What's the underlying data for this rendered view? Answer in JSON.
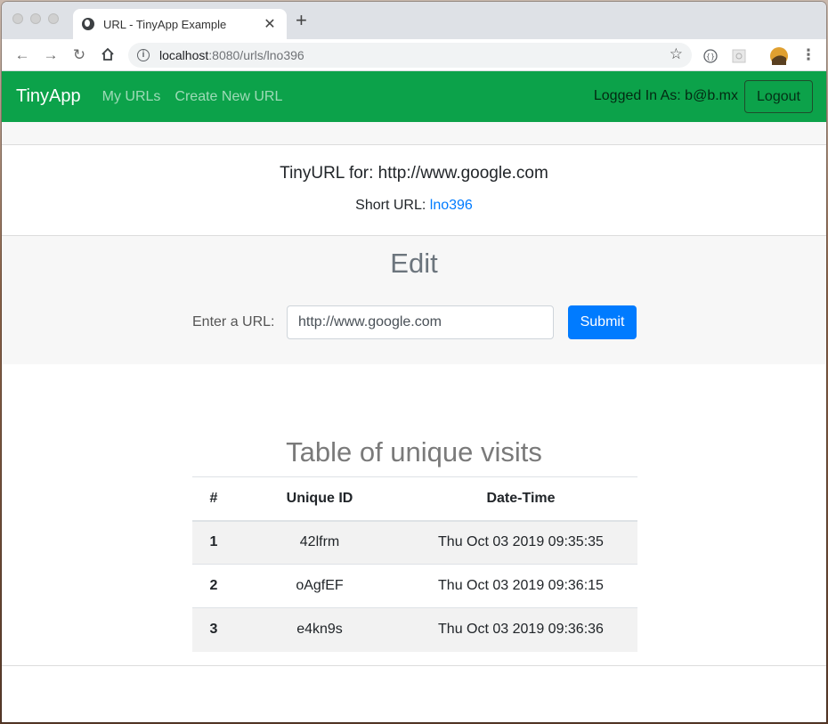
{
  "browser": {
    "tab_title": "URL - TinyApp Example",
    "tab_close": "✕",
    "new_tab": "+",
    "url_host": "localhost",
    "url_path": ":8080/urls/lno396",
    "icons": [
      "back-icon",
      "forward-icon",
      "reload-icon",
      "home-icon",
      "info-icon",
      "star-icon",
      "extension-icon",
      "profile-avatar",
      "menu-icon"
    ]
  },
  "navbar": {
    "brand": "TinyApp",
    "links": [
      "My URLs",
      "Create New URL"
    ],
    "logged_in_text": "Logged In As: b@b.mx",
    "logout_label": "Logout",
    "color": "#0ca24a"
  },
  "url_info": {
    "title": "TinyURL for: http://www.google.com",
    "short_label": "Short URL: ",
    "short_value": "lno396"
  },
  "edit": {
    "heading": "Edit",
    "label": "Enter a URL:",
    "input_value": "http://www.google.com",
    "submit_label": "Submit"
  },
  "visits": {
    "heading": "Table of unique visits",
    "columns": [
      "#",
      "Unique ID",
      "Date-Time"
    ],
    "rows": [
      [
        "1",
        "42lfrm",
        "Thu Oct 03 2019 09:35:35"
      ],
      [
        "2",
        "oAgfEF",
        "Thu Oct 03 2019 09:36:15"
      ],
      [
        "3",
        "e4kn9s",
        "Thu Oct 03 2019 09:36:36"
      ]
    ]
  }
}
